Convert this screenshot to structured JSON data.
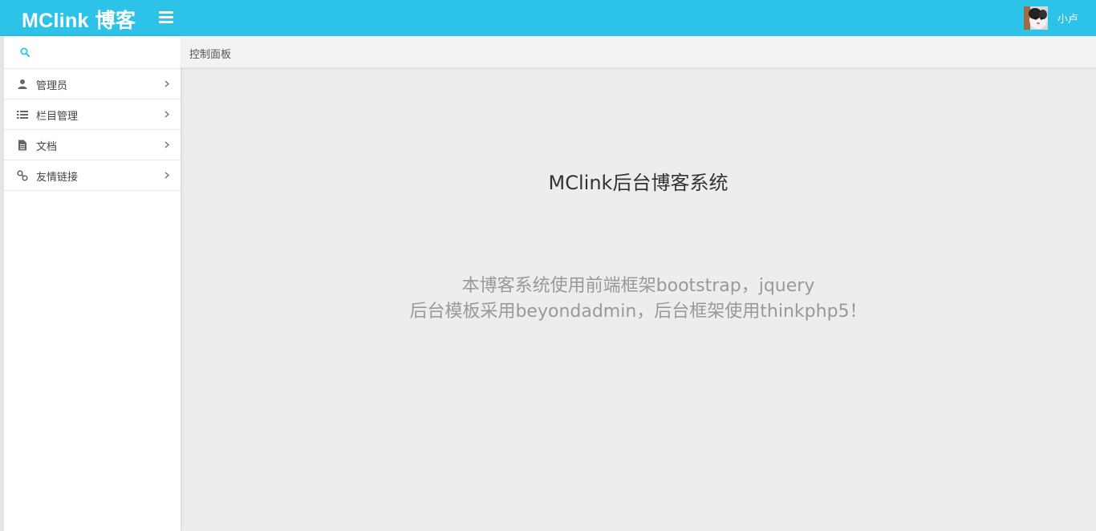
{
  "header": {
    "brand": "MClink",
    "brand_sub": "博客",
    "menu_icon": "hamburger-menu-icon",
    "avatar_icon": "user-avatar",
    "username": "小卢",
    "bg_color": "#2dc3e8"
  },
  "sidebar": {
    "search": {
      "icon": "search-icon",
      "value": "",
      "placeholder": ""
    },
    "items": [
      {
        "icon": "user-icon",
        "label": "管理员"
      },
      {
        "icon": "list-icon",
        "label": "栏目管理"
      },
      {
        "icon": "file-icon",
        "label": "文档"
      },
      {
        "icon": "link-icon",
        "label": "友情链接"
      }
    ]
  },
  "breadcrumb": {
    "label": "控制面板"
  },
  "main": {
    "title": "MClink后台博客系统",
    "desc_line1": "本博客系统使用前端框架bootstrap，jquery",
    "desc_line2": "后台模板采用beyondadmin，后台框架使用thinkphp5！"
  }
}
